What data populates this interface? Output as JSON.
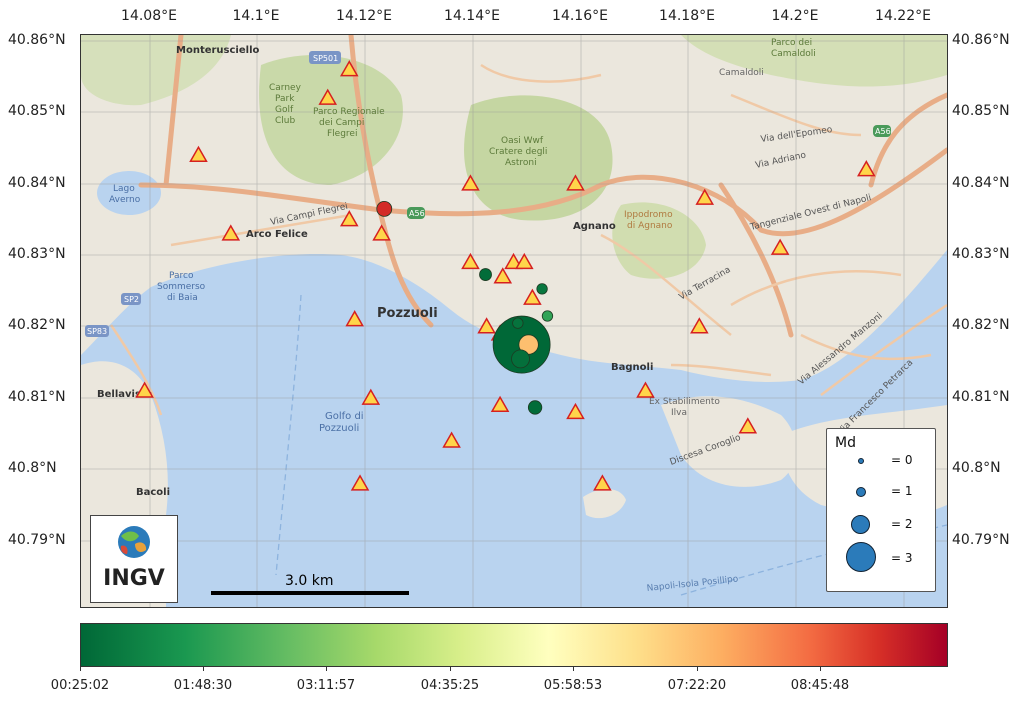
{
  "axes": {
    "top_ticks": [
      "14.08°E",
      "14.1°E",
      "14.12°E",
      "14.14°E",
      "14.16°E",
      "14.18°E",
      "14.2°E",
      "14.22°E"
    ],
    "left_ticks": [
      "40.86°N",
      "40.85°N",
      "40.84°N",
      "40.83°N",
      "40.82°N",
      "40.81°N",
      "40.8°N",
      "40.79°N"
    ],
    "right_ticks": [
      "40.86°N",
      "40.85°N",
      "40.84°N",
      "40.83°N",
      "40.82°N",
      "40.81°N",
      "40.8°N",
      "40.79°N"
    ]
  },
  "map_labels": {
    "monterusciello": "Monterusciello",
    "sp501": "SP501",
    "carney": "Carney",
    "park": "Park",
    "golf": "Golf",
    "club": "Club",
    "parco_reg": "Parco Regionale",
    "dei_campi": "dei Campi",
    "flegrei": "Flegrei",
    "oasi": "Oasi Wwf",
    "cratere": "Cratere degli",
    "astroni": "Astroni",
    "parco_camaldoli": "Parco dei",
    "camaldoli_a": "Camaldoli",
    "camaldoli": "Camaldoli",
    "via_epomeo": "Via dell'Epomeo",
    "via_adriano": "Via Adriano",
    "tangenziale": "Tangenziale Ovest di Napoli",
    "lago": "Lago",
    "averno": "Averno",
    "arco_felice": "Arco Felice",
    "via_campi": "Via Campi Flegrei",
    "a56": "A56",
    "a56b": "A56",
    "a56c": "A56",
    "agnano": "Agnano",
    "ippodromo": "Ippodromo",
    "di_agnano": "di Agnano",
    "pozzuoli": "Pozzuoli",
    "parco_sommerso": "Parco",
    "sommerso": "Sommerso",
    "di_baia": "di Baia",
    "sp2": "SP2",
    "sp83": "SP83",
    "bellavista": "Bellavista",
    "golfo_di": "Golfo di",
    "pozzuoli_sea": "Pozzuoli",
    "bagnoli": "Bagnoli",
    "ex_stab": "Ex Stabilimento",
    "ilva": "Ilva",
    "bacoli": "Bacoli",
    "via_terracina": "Via Terracina",
    "napoli_posillipo": "Napoli-Isola Posillipo",
    "via_coroglio": "Discesa Coroglio",
    "via_manzoni": "Via Alessandro Manzoni",
    "via_posillipo": "Via Francesco Petrarca"
  },
  "scalebar": {
    "label": "3.0 km"
  },
  "logo": {
    "text": "INGV"
  },
  "legend": {
    "title": "Md",
    "entries": [
      {
        "label": "= 0",
        "magnitude": 0
      },
      {
        "label": "= 1",
        "magnitude": 1
      },
      {
        "label": "= 2",
        "magnitude": 2
      },
      {
        "label": "= 3",
        "magnitude": 3
      }
    ]
  },
  "colorbar": {
    "ticks": [
      "00:25:02",
      "01:48:30",
      "03:11:57",
      "04:35:25",
      "05:58:53",
      "07:22:20",
      "08:45:48"
    ]
  },
  "colors": {
    "sea": "#b9d3ef",
    "station_fill": "#ffd54a",
    "station_stroke": "#d62020",
    "event_early": "#1b6b3a",
    "event_mid": "#f5a15a",
    "event_late": "#8b0a1e",
    "legend_circle": "#2b7bba"
  },
  "chart_data": {
    "type": "scatter",
    "x_range": [
      14.072,
      14.228
    ],
    "y_range": [
      40.783,
      40.861
    ],
    "stations": [
      {
        "lon": 14.117,
        "lat": 40.856
      },
      {
        "lon": 14.113,
        "lat": 40.852
      },
      {
        "lon": 14.089,
        "lat": 40.844
      },
      {
        "lon": 14.117,
        "lat": 40.835
      },
      {
        "lon": 14.123,
        "lat": 40.833
      },
      {
        "lon": 14.095,
        "lat": 40.833
      },
      {
        "lon": 14.1395,
        "lat": 40.84
      },
      {
        "lon": 14.159,
        "lat": 40.84
      },
      {
        "lon": 14.183,
        "lat": 40.838
      },
      {
        "lon": 14.213,
        "lat": 40.842
      },
      {
        "lon": 14.197,
        "lat": 40.831
      },
      {
        "lon": 14.1395,
        "lat": 40.829
      },
      {
        "lon": 14.1455,
        "lat": 40.827
      },
      {
        "lon": 14.1475,
        "lat": 40.829
      },
      {
        "lon": 14.1495,
        "lat": 40.829
      },
      {
        "lon": 14.151,
        "lat": 40.824
      },
      {
        "lon": 14.118,
        "lat": 40.821
      },
      {
        "lon": 14.1425,
        "lat": 40.82
      },
      {
        "lon": 14.145,
        "lat": 40.819
      },
      {
        "lon": 14.182,
        "lat": 40.82
      },
      {
        "lon": 14.079,
        "lat": 40.811
      },
      {
        "lon": 14.121,
        "lat": 40.81
      },
      {
        "lon": 14.145,
        "lat": 40.809
      },
      {
        "lon": 14.159,
        "lat": 40.808
      },
      {
        "lon": 14.172,
        "lat": 40.811
      },
      {
        "lon": 14.191,
        "lat": 40.806
      },
      {
        "lon": 14.136,
        "lat": 40.804
      },
      {
        "lon": 14.119,
        "lat": 40.798
      },
      {
        "lon": 14.164,
        "lat": 40.798
      }
    ],
    "events": [
      {
        "lon": 14.1235,
        "lat": 40.8365,
        "md": 0.6,
        "time": "08:50:00"
      },
      {
        "lon": 14.1423,
        "lat": 40.8273,
        "md": 0.4,
        "time": "00:30:00"
      },
      {
        "lon": 14.1528,
        "lat": 40.8253,
        "md": 0.3,
        "time": "00:45:00"
      },
      {
        "lon": 14.1538,
        "lat": 40.8215,
        "md": 0.3,
        "time": "01:50:00"
      },
      {
        "lon": 14.1483,
        "lat": 40.8205,
        "md": 0.3,
        "time": "00:40:00"
      },
      {
        "lon": 14.149,
        "lat": 40.8175,
        "md": 3.4,
        "time": "00:25:02"
      },
      {
        "lon": 14.1488,
        "lat": 40.8155,
        "md": 0.8,
        "time": "00:35:00"
      },
      {
        "lon": 14.1503,
        "lat": 40.8175,
        "md": 0.9,
        "time": "06:50:00"
      },
      {
        "lon": 14.1515,
        "lat": 40.8087,
        "md": 0.5,
        "time": "00:30:00"
      }
    ]
  }
}
